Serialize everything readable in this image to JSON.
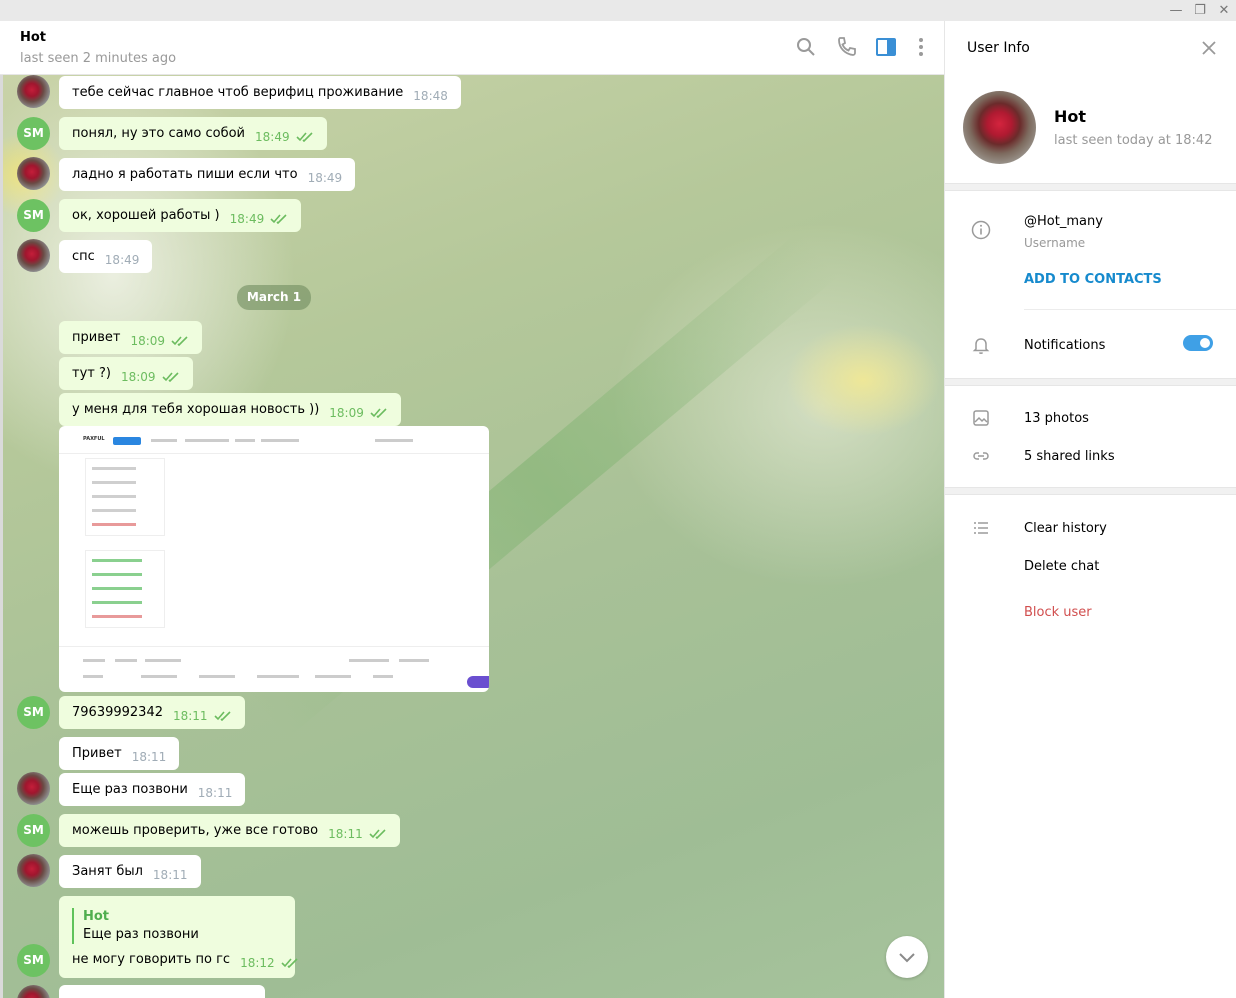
{
  "window": {
    "controls": [
      "—",
      "❐",
      "✕"
    ]
  },
  "chat_header": {
    "title": "Hot",
    "status": "last seen 2 minutes ago"
  },
  "messages": [
    {
      "dir": "in",
      "text": "тебе сейчас главное чтоб верифиц проживание",
      "time": "18:48"
    },
    {
      "dir": "out",
      "avatar": "SM",
      "text": "понял, ну это само собой",
      "time": "18:49"
    },
    {
      "dir": "in",
      "text": "ладно я работать пиши если что",
      "time": "18:49"
    },
    {
      "dir": "out",
      "avatar": "SM",
      "text": "ок, хорошей работы )",
      "time": "18:49"
    },
    {
      "dir": "in",
      "text": "спс",
      "time": "18:49"
    },
    {
      "dir": "out",
      "text": "привет",
      "time": "18:09"
    },
    {
      "dir": "out",
      "text": "тут ?)",
      "time": "18:09"
    },
    {
      "dir": "out",
      "text": "у меня для тебя хорошая новость ))",
      "time": "18:09"
    },
    {
      "dir": "out",
      "avatar": "SM",
      "text": "79639992342",
      "time": "18:11"
    },
    {
      "dir": "in",
      "text": "Привет",
      "time": "18:11"
    },
    {
      "dir": "in",
      "text": "Еще раз позвони",
      "time": "18:11"
    },
    {
      "dir": "out",
      "avatar": "SM",
      "text": "можешь проверить, уже все готово",
      "time": "18:11"
    },
    {
      "dir": "in",
      "text": "Занят был",
      "time": "18:11"
    }
  ],
  "date_separator": "March 1",
  "reply_message": {
    "quote_name": "Hot",
    "quote_text": "Еще раз позвони",
    "text": "не могу говорить по гс",
    "time": "18:12",
    "avatar": "SM"
  },
  "screenshot_preview": {
    "logo": "PAXFUL"
  },
  "user_info": {
    "title": "User Info",
    "name": "Hot",
    "status": "last seen today at 18:42",
    "username": "@Hot_many",
    "username_label": "Username",
    "add_contact": "ADD TO CONTACTS",
    "notifications": "Notifications",
    "notifications_on": true,
    "photos": "13 photos",
    "links": "5 shared links",
    "clear_history": "Clear history",
    "delete_chat": "Delete chat",
    "block_user": "Block user"
  },
  "colors": {
    "accent": "#168acd",
    "out_bubble": "#effdde",
    "check": "#6cbc5f",
    "danger": "#d14e4e",
    "avatar_sm": "#6dc262"
  }
}
